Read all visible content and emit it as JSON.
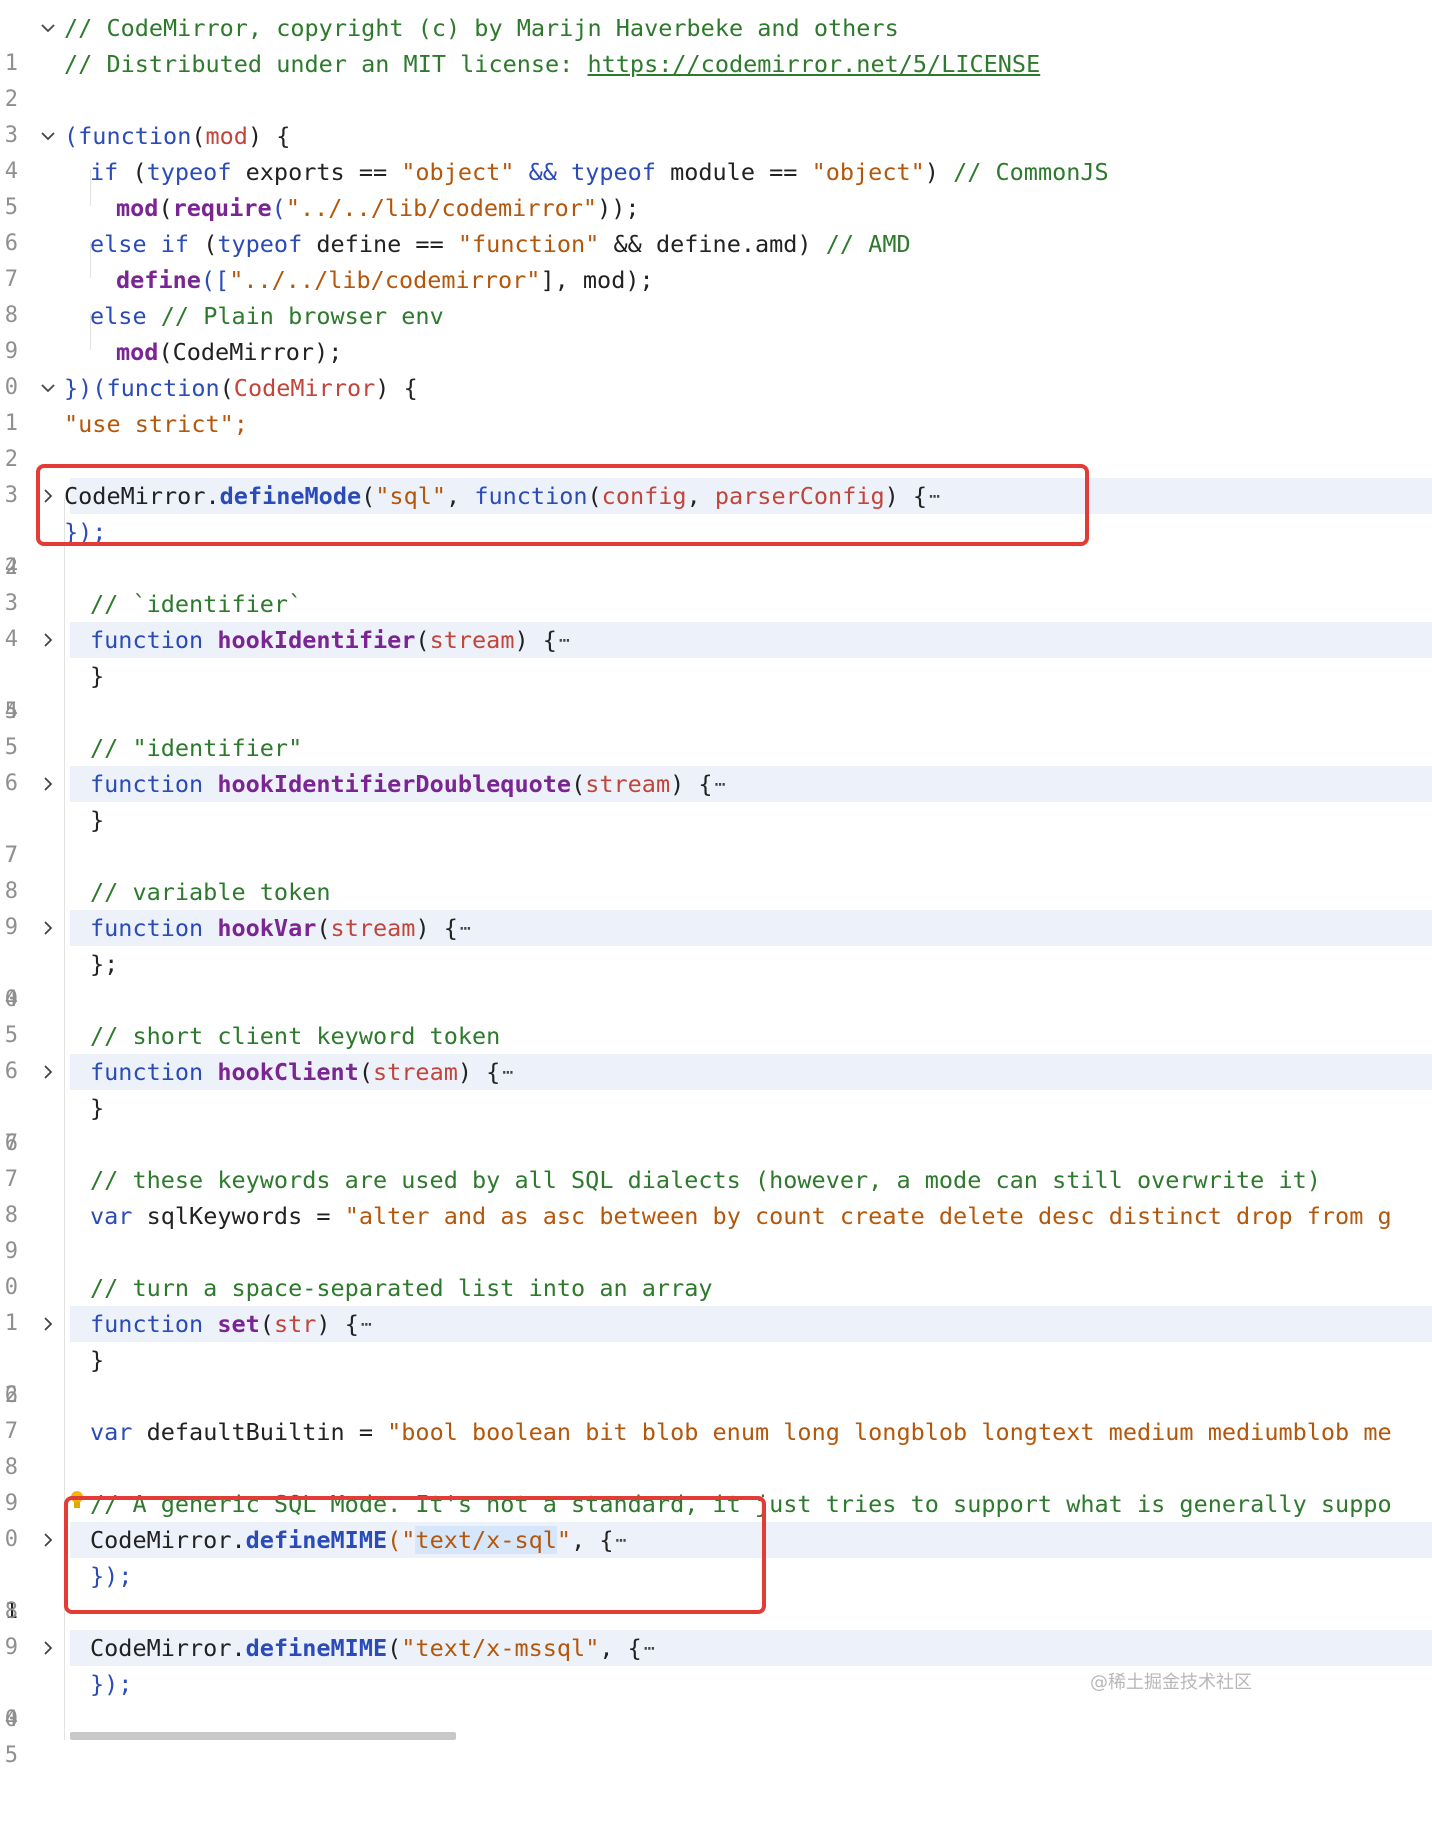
{
  "gutter": [
    "1",
    "2",
    "3",
    "4",
    "5",
    "6",
    "7",
    "8",
    "9",
    "0",
    "1",
    "2",
    "3",
    "4",
    "2",
    "3",
    "4",
    "5",
    "4",
    "5",
    "6",
    "7",
    "7",
    "8",
    "9",
    "0",
    "4",
    "5",
    "6",
    "7",
    "6",
    "7",
    "8",
    "9",
    "0",
    "1",
    "2",
    "6",
    "7",
    "8",
    "9",
    "0",
    "1",
    "8",
    "9",
    "0",
    "4",
    "5"
  ],
  "lines": {
    "l1": "// CodeMirror, copyright (c) by Marijn Haverbeke and others",
    "l2a": "// Distributed under an MIT license: ",
    "l2b": "https://codemirror.net/5/LICENSE",
    "l4a": "(",
    "l4b": "function",
    "l4c": "(",
    "l4d": "mod",
    "l4e": ") {",
    "l5a": "if",
    "l5b": " (",
    "l5c": "typeof",
    "l5d": " exports == ",
    "l5e": "\"object\"",
    "l5f": " && ",
    "l5g": "typeof",
    "l5h": " module == ",
    "l5i": "\"object\"",
    "l5j": ") ",
    "l5k": "// CommonJS",
    "l6a": "mod",
    "l6b": "(",
    "l6c": "require",
    "l6d": "(",
    "l6e": "\"../../lib/codemirror\"",
    "l6f": "));",
    "l7a": "else",
    "l7b": " ",
    "l7c": "if",
    "l7d": " (",
    "l7e": "typeof",
    "l7f": " define == ",
    "l7g": "\"function\"",
    "l7h": " && define.amd) ",
    "l7i": "// AMD",
    "l8a": "define",
    "l8b": "([",
    "l8c": "\"../../lib/codemirror\"",
    "l8d": "], mod);",
    "l9a": "else",
    "l9b": " ",
    "l9c": "// Plain browser env",
    "l10a": "mod",
    "l10b": "(CodeMirror);",
    "l11a": "})(",
    "l11b": "function",
    "l11c": "(",
    "l11d": "CodeMirror",
    "l11e": ") {",
    "l12": "\"use strict\";",
    "l14a": "CodeMirror.",
    "l14b": "defineMode",
    "l14c": "(",
    "l14d": "\"sql\"",
    "l14e": ", ",
    "l14f": "function",
    "l14g": "(",
    "l14h": "config",
    "l14i": ", ",
    "l14j": "parserConfig",
    "l14k": ") {",
    "l15": "});",
    "l17": "// `identifier`",
    "l18a": "function",
    "l18b": " ",
    "l18c": "hookIdentifier",
    "l18d": "(",
    "l18e": "stream",
    "l18f": ") {",
    "l19": "}",
    "l21": "// \"identifier\"",
    "l22a": "function",
    "l22b": " ",
    "l22c": "hookIdentifierDoublequote",
    "l22d": "(",
    "l22e": "stream",
    "l22f": ") {",
    "l23": "}",
    "l25": "// variable token",
    "l26a": "function",
    "l26b": " ",
    "l26c": "hookVar",
    "l26d": "(",
    "l26e": "stream",
    "l26f": ") {",
    "l27": "};",
    "l29": "// short client keyword token",
    "l30a": "function",
    "l30b": " ",
    "l30c": "hookClient",
    "l30d": "(",
    "l30e": "stream",
    "l30f": ") {",
    "l31": "}",
    "l33": "// these keywords are used by all SQL dialects (however, a mode can still overwrite it)",
    "l34a": "var",
    "l34b": " sqlKeywords = ",
    "l34c": "\"alter and as asc between by count create delete desc distinct drop from g",
    "l36": "// turn a space-separated list into an array",
    "l37a": "function",
    "l37b": " ",
    "l37c": "set",
    "l37d": "(",
    "l37e": "str",
    "l37f": ") {",
    "l38": "}",
    "l40a": "var",
    "l40b": " defaultBuiltin = ",
    "l40c": "\"bool boolean bit blob enum long longblob longtext medium mediumblob me",
    "l42a": "// A generic SQL Mode. It's not a standard, it ",
    "l42b": "just tries to support what is generally suppo",
    "l43a": "CodeMirror.",
    "l43b": "defineMIME",
    "l43c": "(\"",
    "l43d": "text/x-sql",
    "l43e": "\"",
    "l43f": ", {",
    "l44": "});",
    "l46a": "CodeMirror.",
    "l46b": "defineMIME",
    "l46c": "(",
    "l46d": "\"text/x-mssql\"",
    "l46e": ", {",
    "l47": "});"
  },
  "ellipsis": "⋯",
  "watermark": "@稀土掘金技术社区",
  "icons": {
    "fold_open": "chevron-down-icon",
    "fold_closed": "chevron-right-icon",
    "hint": "lightbulb-icon"
  },
  "colors": {
    "comment": "#2d7a2d",
    "keyword": "#2a4bb8",
    "function": "#7b2493",
    "param": "#c1453a",
    "string": "#b5570b",
    "highlight_box": "#e33b35"
  }
}
